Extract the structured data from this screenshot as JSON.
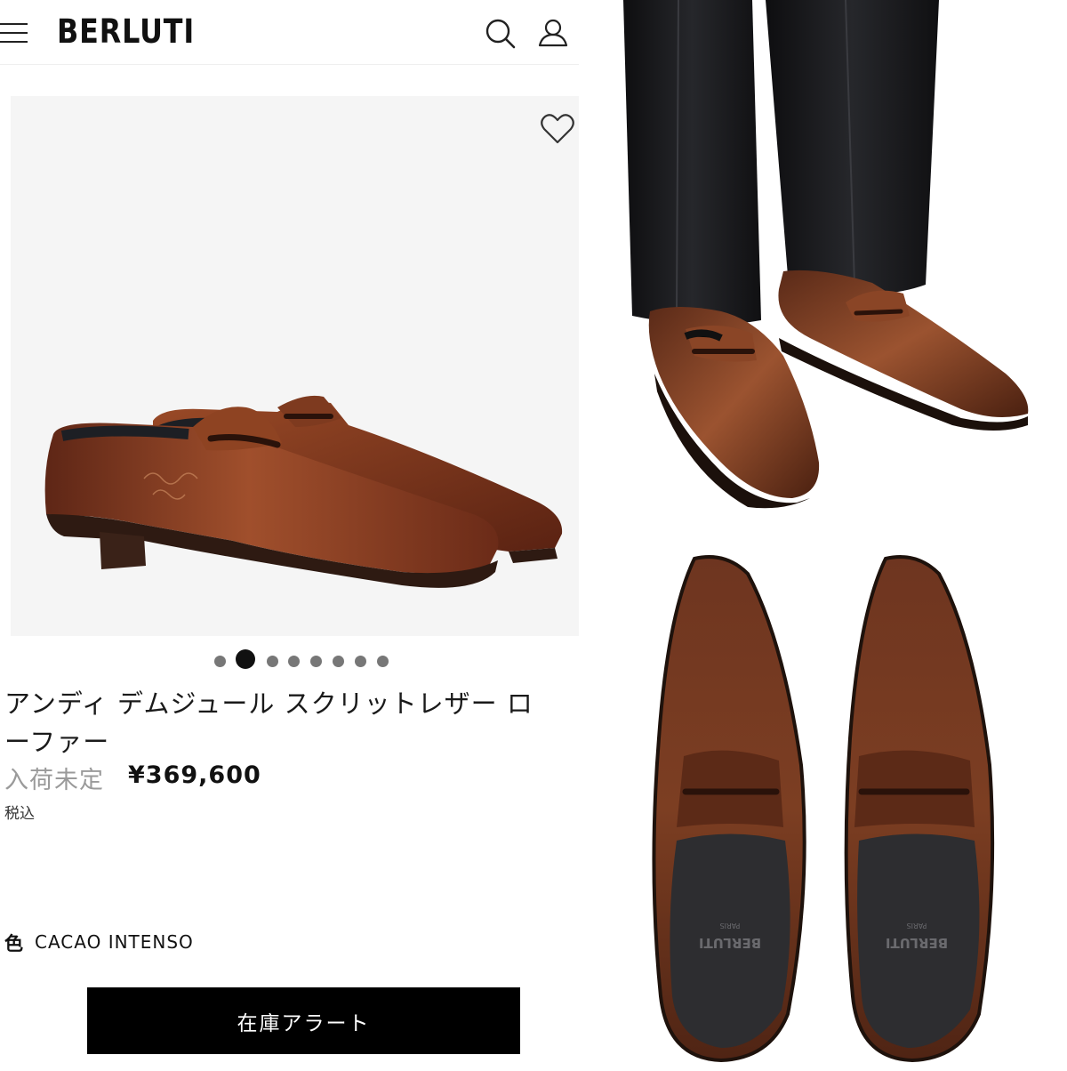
{
  "header": {
    "brand": "BERLUTI",
    "menu_icon": "hamburger-menu-icon",
    "search_icon": "search-icon",
    "account_icon": "account-icon"
  },
  "gallery": {
    "wishlist_icon": "heart-icon",
    "dots_count": 8,
    "active_dot": 2,
    "main_image": "penny-loafer-pair-side-view"
  },
  "product": {
    "title": "アンディ デムジュール スクリットレザー ローファー",
    "availability": "入荷未定",
    "price": "¥369,600",
    "tax_note": "税込",
    "color_label": "色",
    "color_value": "CACAO INTENSO"
  },
  "actions": {
    "stock_alert_label": "在庫アラート"
  },
  "photos": {
    "worn": "loafer-worn-with-black-trousers",
    "top": "loafer-pair-top-view",
    "insole_brand": "BERLUTI",
    "insole_sub": "PARIS"
  },
  "colors": {
    "accent": "#000000",
    "leather": "#7a3b22",
    "muted_text": "#9a9a9a",
    "image_bg": "#f5f5f5"
  }
}
